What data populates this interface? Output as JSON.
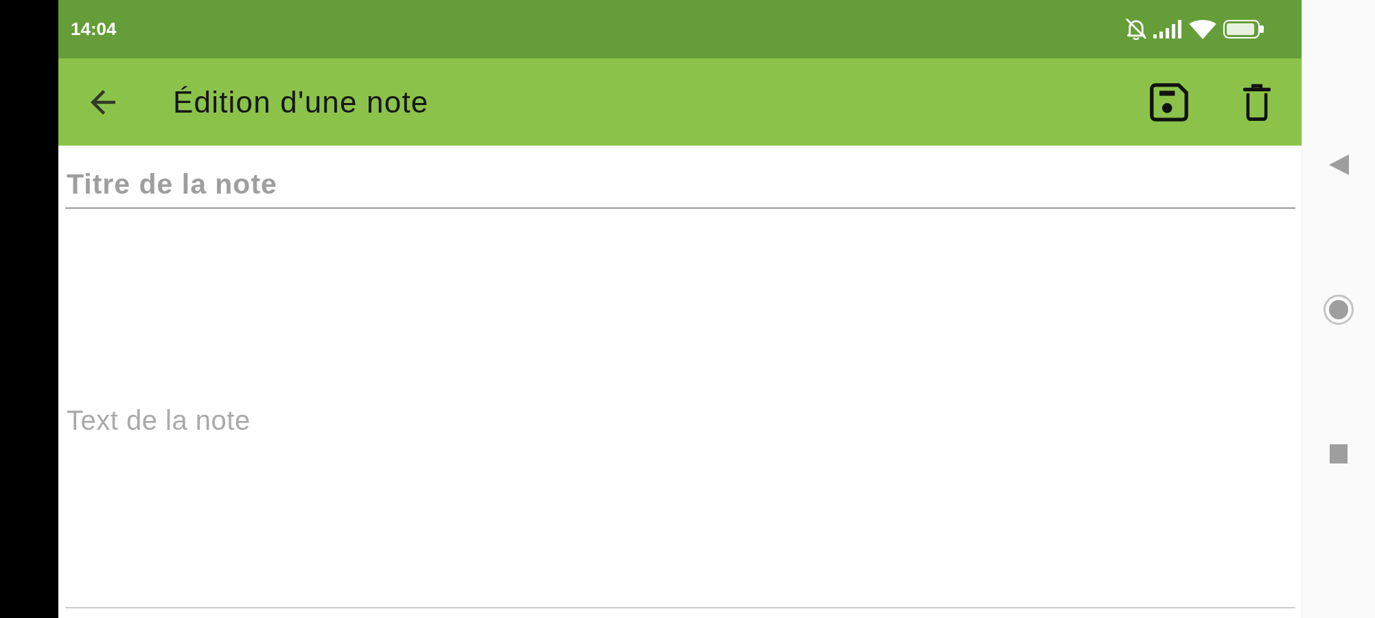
{
  "status_bar": {
    "time": "14:04"
  },
  "app_bar": {
    "title": "Édition d'une note"
  },
  "form": {
    "title_field": {
      "placeholder": "Titre de la note"
    },
    "body_field": {
      "placeholder": "Text de la note"
    }
  }
}
